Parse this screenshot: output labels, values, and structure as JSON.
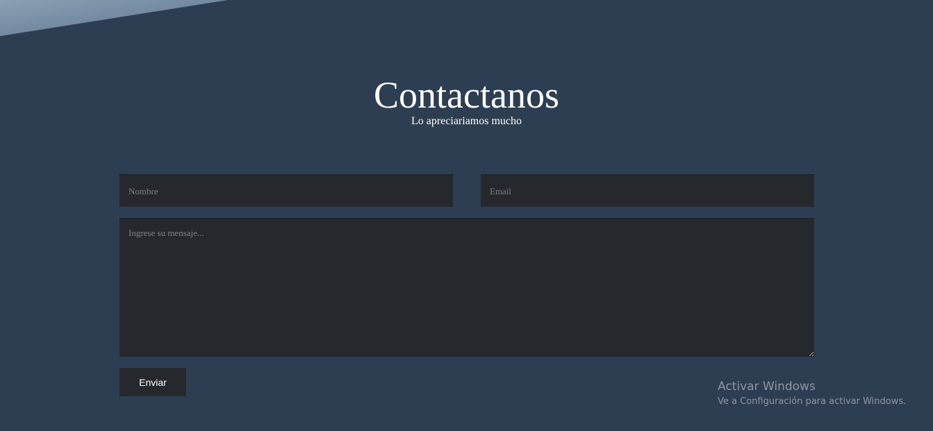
{
  "contact": {
    "title": "Contactanos",
    "subtitle": "Lo apreciariamos mucho"
  },
  "form": {
    "name_placeholder": "Nombre",
    "email_placeholder": "Email",
    "message_placeholder": "Ingrese su mensaje...",
    "submit_label": "Enviar"
  },
  "watermark": {
    "title": "Activar Windows",
    "text": "Ve a Configuración para activar Windows."
  },
  "colors": {
    "background": "#2e3e52",
    "field_background": "#25292d",
    "corner_image": "#6d859c"
  }
}
